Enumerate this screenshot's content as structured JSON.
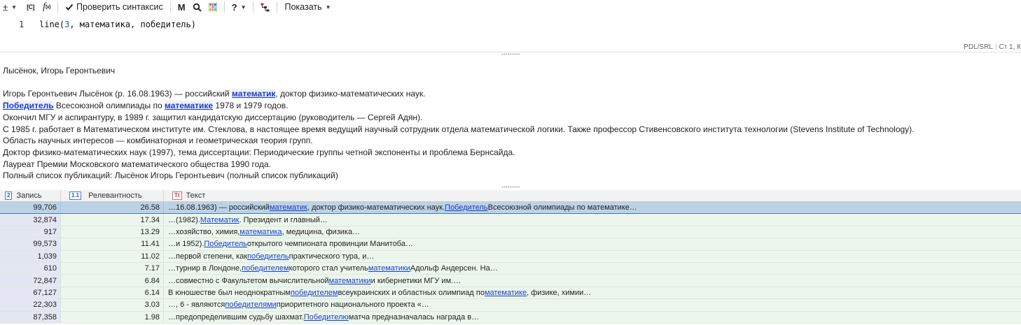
{
  "toolbar": {
    "plus_minus_icon": "±",
    "bracket_c_icon": "[C]",
    "fx_icon": "f(x)",
    "check_syntax_label": "Проверить синтаксис",
    "m_label": "M",
    "show_label": "Показать",
    "help_label": "?"
  },
  "editor": {
    "line_number": "1",
    "code_fn": "line(",
    "code_num": "3",
    "code_rest": ", математика, победитель)",
    "status_mode": "PDL/SRL",
    "status_pos": "Ст 1, К"
  },
  "document": {
    "title": "Лысёнок, Игорь Геронтьевич",
    "line1_a": "Игорь Геронтьевич Лысёнок (р. 16.08.1963) — российский ",
    "line1_hl": "математик",
    "line1_b": ", доктор физико-математических наук.",
    "line2_hl1": "Победитель",
    "line2_a": " Всесоюзной олимпиады по ",
    "line2_hl2": "математике",
    "line2_b": " 1978 и 1979 годов.",
    "line3": "Окончил МГУ и аспирантуру, в 1989 г. защитил кандидатскую диссертацию (руководитель — Сергей Адян).",
    "line4": "С 1985 г. работает в Математическом институте им. Стеклова, в настоящее время ведущий научный сотрудник отдела математической логики. Также профессор Стивенсовского института технологии (Stevens Institute of Technology).",
    "line5": "Область научных интересов — комбинаторная и геометрическая теория групп.",
    "line6": "Доктор физико-математических наук (1997), тема диссертации: Периодические группы четной экспоненты и проблема Бернсайда.",
    "line7": "Лауреат Премии Московского математического общества 1990 года.",
    "line8": "Полный список публикаций: Лысёнок Игорь Геронтьевич (полный список публикаций)"
  },
  "grid": {
    "headers": {
      "record_icon": "2",
      "record": "Запись",
      "relevance_icon": "1.1",
      "relevance": "Релевантность",
      "text_icon": "Tt",
      "text": "Текст"
    },
    "rows": [
      {
        "record": "99,706",
        "relevance": "26.58",
        "text": [
          [
            "…16.08.1963) — российский ",
            false
          ],
          [
            "математик",
            true
          ],
          [
            ", доктор физико-математических наук. ",
            false
          ],
          [
            "Победитель",
            true
          ],
          [
            " Всесоюзной олимпиады по математике…",
            false
          ]
        ]
      },
      {
        "record": "32,874",
        "relevance": "17.34",
        "text": [
          [
            "…(1982). ",
            false
          ],
          [
            "Математик",
            true
          ],
          [
            ". Президент и главный…",
            false
          ]
        ]
      },
      {
        "record": "917",
        "relevance": "13.29",
        "text": [
          [
            "…хозяйство, химия, ",
            false
          ],
          [
            "математика",
            true
          ],
          [
            ", медицина, физика…",
            false
          ]
        ]
      },
      {
        "record": "99,573",
        "relevance": "11.41",
        "text": [
          [
            "…и 1952). ",
            false
          ],
          [
            "Победитель",
            true
          ],
          [
            " открытого чемпионата провинции Манитоба…",
            false
          ]
        ]
      },
      {
        "record": "1,039",
        "relevance": "11.02",
        "text": [
          [
            "…первой степени, как ",
            false
          ],
          [
            "победитель",
            true
          ],
          [
            " практического тура, и…",
            false
          ]
        ]
      },
      {
        "record": "610",
        "relevance": "7.17",
        "text": [
          [
            "…турнир в Лондоне, ",
            false
          ],
          [
            "победителем",
            true
          ],
          [
            " которого стал учитель ",
            false
          ],
          [
            "математики",
            true
          ],
          [
            " Адольф Андерсен. На…",
            false
          ]
        ]
      },
      {
        "record": "72,847",
        "relevance": "6.84",
        "text": [
          [
            "…совместно с Факультетом вычислительной ",
            false
          ],
          [
            "математики",
            true
          ],
          [
            " и кибернетики МГУ им.…",
            false
          ]
        ]
      },
      {
        "record": "67,127",
        "relevance": "6.14",
        "text": [
          [
            "В юношестве был неоднократным ",
            false
          ],
          [
            "победителем",
            true
          ],
          [
            " всеукраинских и областных олимпиад по ",
            false
          ],
          [
            "математике",
            true
          ],
          [
            ", физике, химии…",
            false
          ]
        ]
      },
      {
        "record": "22,303",
        "relevance": "3.03",
        "text": [
          [
            "…, 6 - являются ",
            false
          ],
          [
            "победителями",
            true
          ],
          [
            " приоритетного национального проекта «…",
            false
          ]
        ]
      },
      {
        "record": "87,358",
        "relevance": "1.98",
        "text": [
          [
            "…предопределившим судьбу шахмат. ",
            false
          ],
          [
            "Победителю",
            true
          ],
          [
            " матча предназначалась награда в…",
            false
          ]
        ]
      }
    ]
  }
}
